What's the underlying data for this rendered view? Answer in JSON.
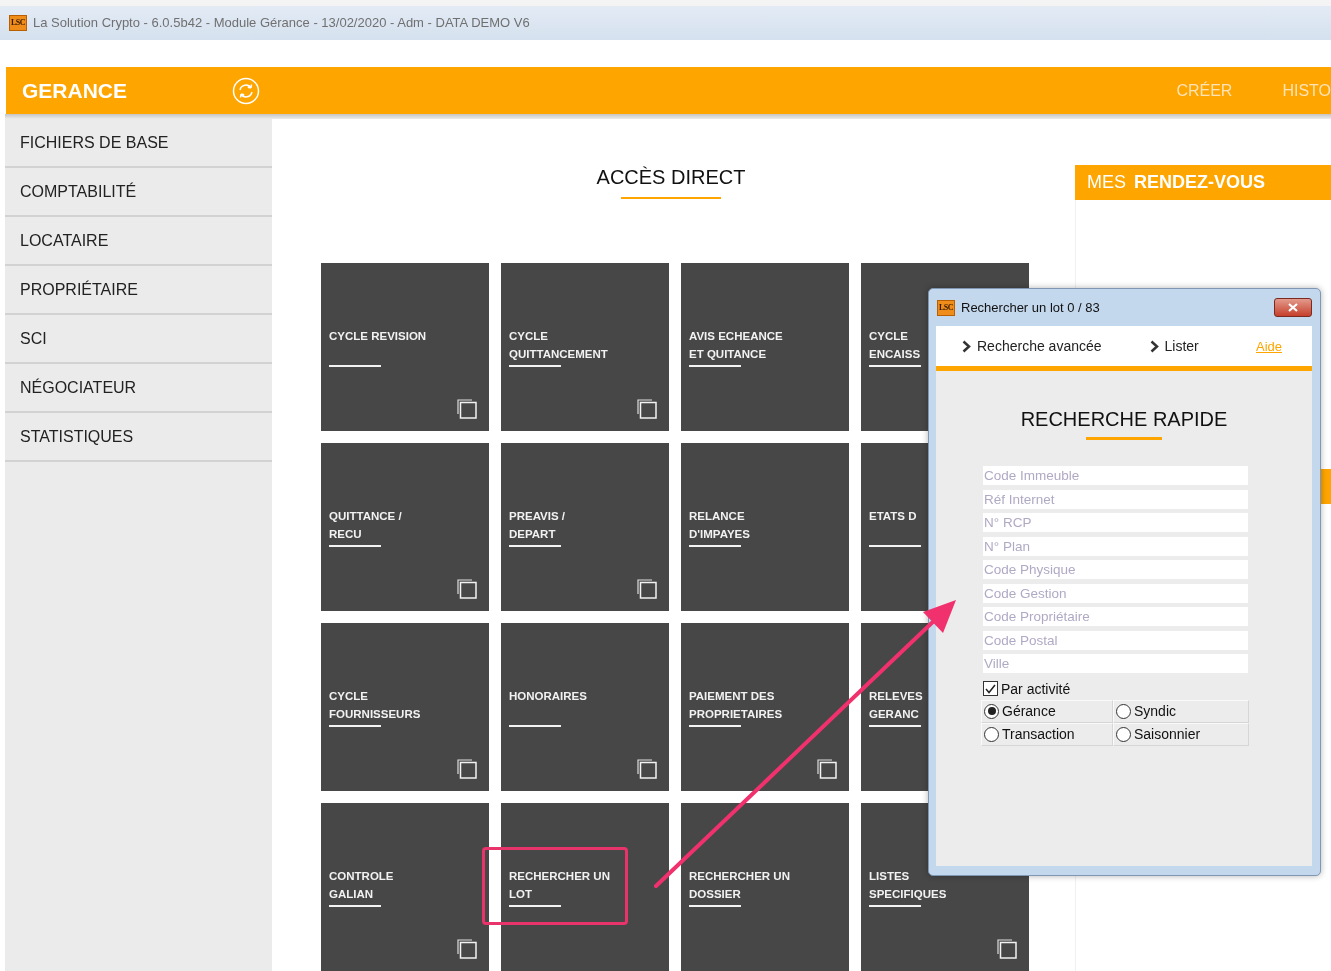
{
  "window": {
    "logo": "LSC",
    "title": "La Solution Crypto - 6.0.5b42 - Module Gérance - 13/02/2020 - Adm - DATA DEMO V6"
  },
  "header": {
    "title": "GERANCE",
    "menu": [
      "CRÉER",
      "HISTO"
    ]
  },
  "sidebar": {
    "items": [
      "FICHIERS DE BASE",
      "COMPTABILITÉ",
      "LOCATAIRE",
      "PROPRIÉTAIRE",
      "SCI",
      "NÉGOCIATEUR",
      "STATISTIQUES"
    ]
  },
  "direct_access": {
    "title": "ACCÈS DIRECT",
    "tiles": [
      {
        "lines": [
          "CYCLE REVISION"
        ],
        "copy_icon": true,
        "annotated": false
      },
      {
        "lines": [
          "CYCLE",
          "QUITTANCEMENT"
        ],
        "copy_icon": true,
        "annotated": false
      },
      {
        "lines": [
          "AVIS ECHEANCE",
          "ET QUITANCE"
        ],
        "copy_icon": false,
        "annotated": false
      },
      {
        "lines": [
          "CYCLE",
          "ENCAISS"
        ],
        "copy_icon": false,
        "annotated": false
      },
      {
        "lines": [
          "QUITTANCE /",
          "RECU"
        ],
        "copy_icon": true,
        "annotated": false
      },
      {
        "lines": [
          "PREAVIS /",
          "DEPART"
        ],
        "copy_icon": true,
        "annotated": false
      },
      {
        "lines": [
          "RELANCE",
          "D'IMPAYES"
        ],
        "copy_icon": false,
        "annotated": false
      },
      {
        "lines": [
          "ETATS D"
        ],
        "copy_icon": false,
        "annotated": false
      },
      {
        "lines": [
          "CYCLE",
          "FOURNISSEURS"
        ],
        "copy_icon": true,
        "annotated": false
      },
      {
        "lines": [
          "HONORAIRES"
        ],
        "copy_icon": true,
        "annotated": false
      },
      {
        "lines": [
          "PAIEMENT DES",
          "PROPRIETAIRES"
        ],
        "copy_icon": true,
        "annotated": false
      },
      {
        "lines": [
          "RELEVES",
          "GERANC"
        ],
        "copy_icon": false,
        "annotated": false
      },
      {
        "lines": [
          "CONTROLE",
          "GALIAN"
        ],
        "copy_icon": true,
        "annotated": false
      },
      {
        "lines": [
          "RECHERCHER UN",
          "LOT"
        ],
        "copy_icon": false,
        "annotated": true
      },
      {
        "lines": [
          "RECHERCHER UN",
          "DOSSIER"
        ],
        "copy_icon": false,
        "annotated": false
      },
      {
        "lines": [
          "LISTES",
          "SPECIFIQUES"
        ],
        "copy_icon": true,
        "annotated": false
      }
    ]
  },
  "appointments": {
    "title_light": "MES",
    "title_bold": "RENDEZ-VOUS"
  },
  "dialog": {
    "logo": "LSC",
    "title": "Rechercher un lot 0 / 83",
    "nav": [
      "Recherche avancée",
      "Lister"
    ],
    "help_link": "Aide",
    "heading": "RECHERCHE RAPIDE",
    "fields": [
      {
        "placeholder": "Code Immeuble"
      },
      {
        "placeholder": "Réf Internet"
      },
      {
        "placeholder": "N° RCP"
      },
      {
        "placeholder": "N° Plan"
      },
      {
        "placeholder": "Code Physique"
      },
      {
        "placeholder": "Code Gestion"
      },
      {
        "placeholder": "Code Propriétaire"
      },
      {
        "placeholder": "Code Postal"
      },
      {
        "placeholder": "Ville"
      }
    ],
    "activity": {
      "label": "Par activité",
      "checked": true
    },
    "options": [
      {
        "label": "Gérance",
        "selected": true
      },
      {
        "label": "Syndic",
        "selected": false
      },
      {
        "label": "Transaction",
        "selected": false
      },
      {
        "label": "Saisonnier",
        "selected": false
      }
    ]
  }
}
